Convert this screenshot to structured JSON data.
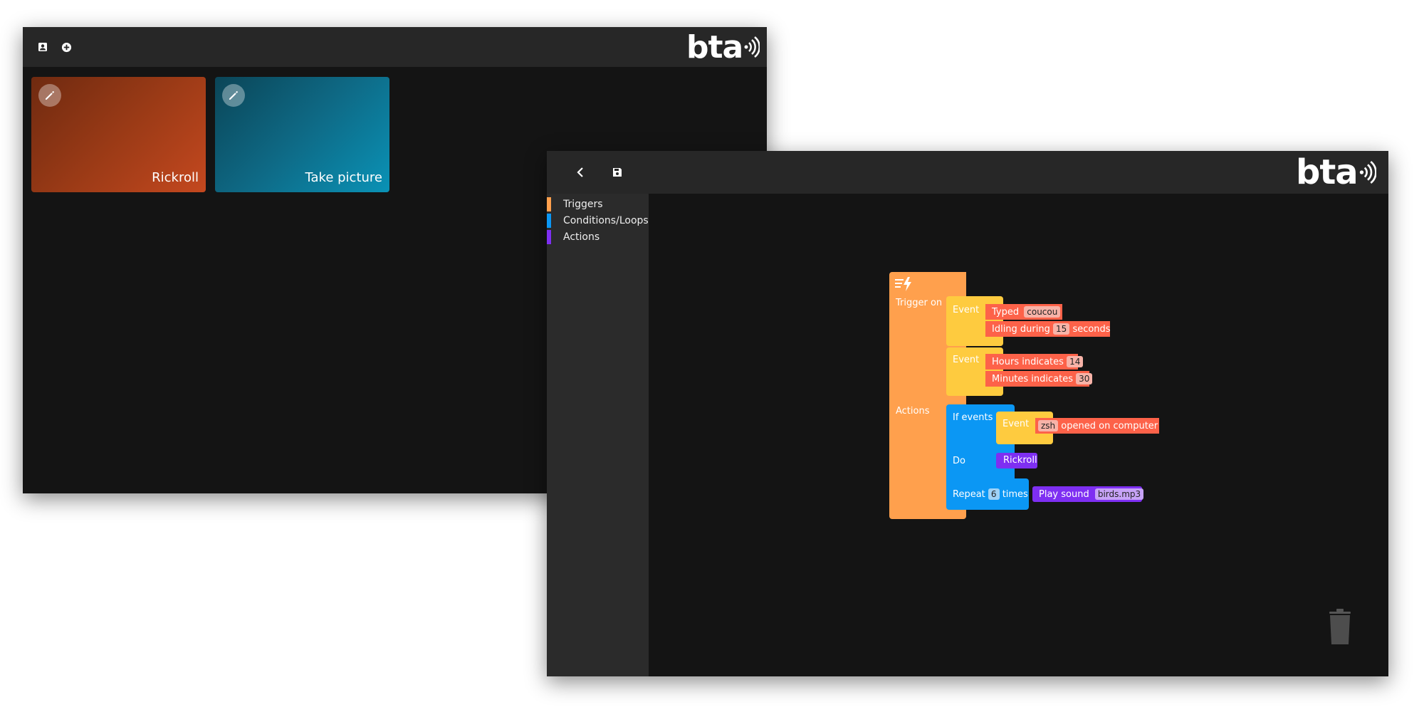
{
  "window_list": {
    "topbar_icons": [
      "contact-icon",
      "add-circle-icon"
    ],
    "brand": "bta",
    "cards": [
      {
        "label": "Rickroll",
        "icon": "edit-icon"
      },
      {
        "label": "Take picture",
        "icon": "edit-icon"
      }
    ]
  },
  "window_editor": {
    "topbar_icons": [
      "back-chevron-icon",
      "save-icon"
    ],
    "brand": "bta",
    "categories": [
      {
        "label": "Triggers",
        "color": "#ffa04d"
      },
      {
        "label": "Conditions/Loops",
        "color": "#0b97f4"
      },
      {
        "label": "Actions",
        "color": "#7e2ff2"
      }
    ],
    "blocks": {
      "trigger_on": "Trigger on",
      "actions": "Actions",
      "event": "Event",
      "typed": "Typed",
      "typed_value": "coucou",
      "idling_during": "Idling during",
      "idling_value": "15",
      "seconds": "seconds",
      "hours_indicates": "Hours indicates",
      "hours_value": "14",
      "minutes_indicates": "Minutes indicates",
      "minutes_value": "30",
      "if_events": "If events",
      "zsh_value": "zsh",
      "opened_on_computer": "opened on computer",
      "do": "Do",
      "rickroll": "Rickroll",
      "repeat": "Repeat",
      "repeat_value": "6",
      "times": "times",
      "play_sound": "Play sound",
      "sound_value": "birds.mp3"
    },
    "trash_icon": "trash-icon"
  },
  "colors": {
    "trigger_orange": "#ffa04d",
    "event_yellow": "#fecb3f",
    "leaf_red": "#fd6249",
    "condition_blue": "#0b97f4",
    "action_purple": "#7e2ff2"
  }
}
